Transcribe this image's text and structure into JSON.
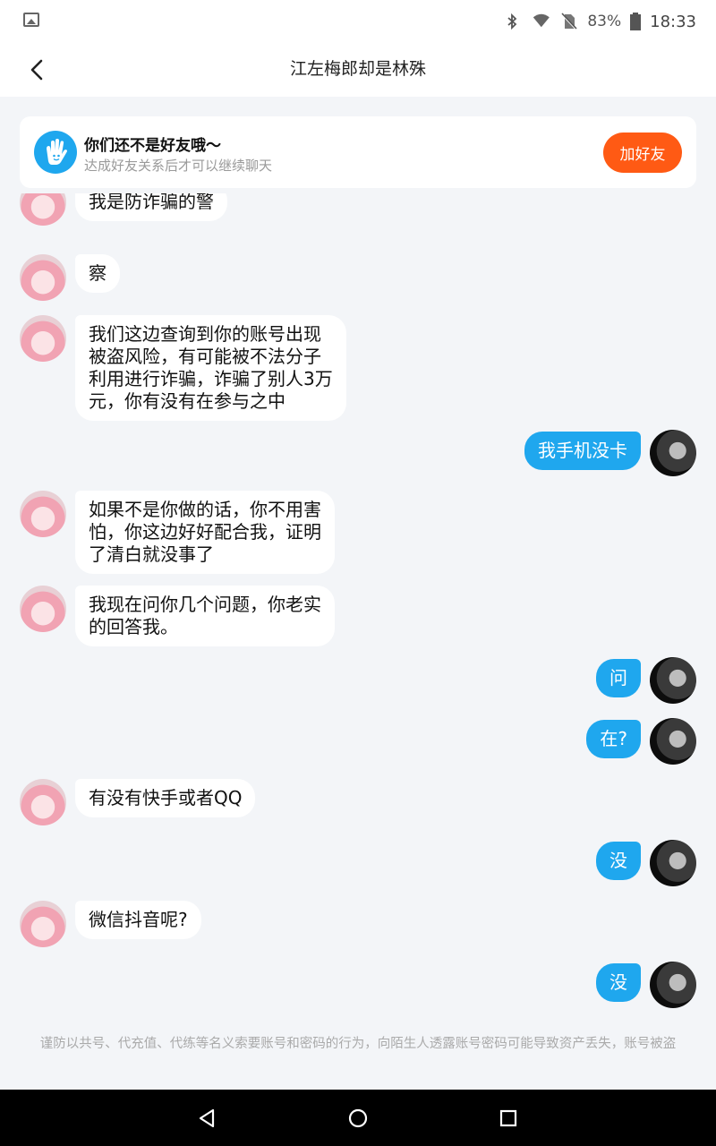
{
  "status_bar": {
    "battery_percent": "83%",
    "time": "18:33",
    "icons": [
      "image-icon",
      "bluetooth-icon",
      "wifi-icon",
      "no-sim-icon",
      "battery-icon"
    ]
  },
  "header": {
    "title": "江左梅郎却是林殊",
    "back_icon": "chevron-left-icon"
  },
  "friend_banner": {
    "title": "你们还不是好友哦～",
    "subtitle": "达成好友关系后才可以继续聊天",
    "button_label": "加好友",
    "icon": "hand-wave-icon"
  },
  "messages": [
    {
      "side": "left",
      "text": "我是防诈骗的警"
    },
    {
      "side": "left",
      "text": "察"
    },
    {
      "side": "left",
      "text": "我们这边查询到你的账号出现\n被盗风险，有可能被不法分子\n利用进行诈骗，诈骗了别人3万\n元，你有没有在参与之中"
    },
    {
      "side": "right",
      "text": "我手机没卡"
    },
    {
      "side": "left",
      "text": "如果不是你做的话，你不用害\n怕，你这边好好配合我，证明\n了清白就没事了"
    },
    {
      "side": "left",
      "text": "我现在问你几个问题，你老实\n的回答我。"
    },
    {
      "side": "right",
      "text": "问"
    },
    {
      "side": "right",
      "text": "在?"
    },
    {
      "side": "left",
      "text": "有没有快手或者QQ"
    },
    {
      "side": "right",
      "text": "没"
    },
    {
      "side": "left",
      "text": "微信抖音呢?"
    },
    {
      "side": "right",
      "text": "没"
    }
  ],
  "footer_note": "谨防以共号、代充值、代练等名义索要账号和密码的行为，向陌生人透露账号密码可能导致资产丢失，账号被盗",
  "colors": {
    "accent_blue": "#1fa7ee",
    "add_friend_orange": "#ff5a14",
    "background": "#f3f5f8"
  },
  "system_nav": [
    "back-triangle-icon",
    "home-circle-icon",
    "recents-square-icon"
  ]
}
